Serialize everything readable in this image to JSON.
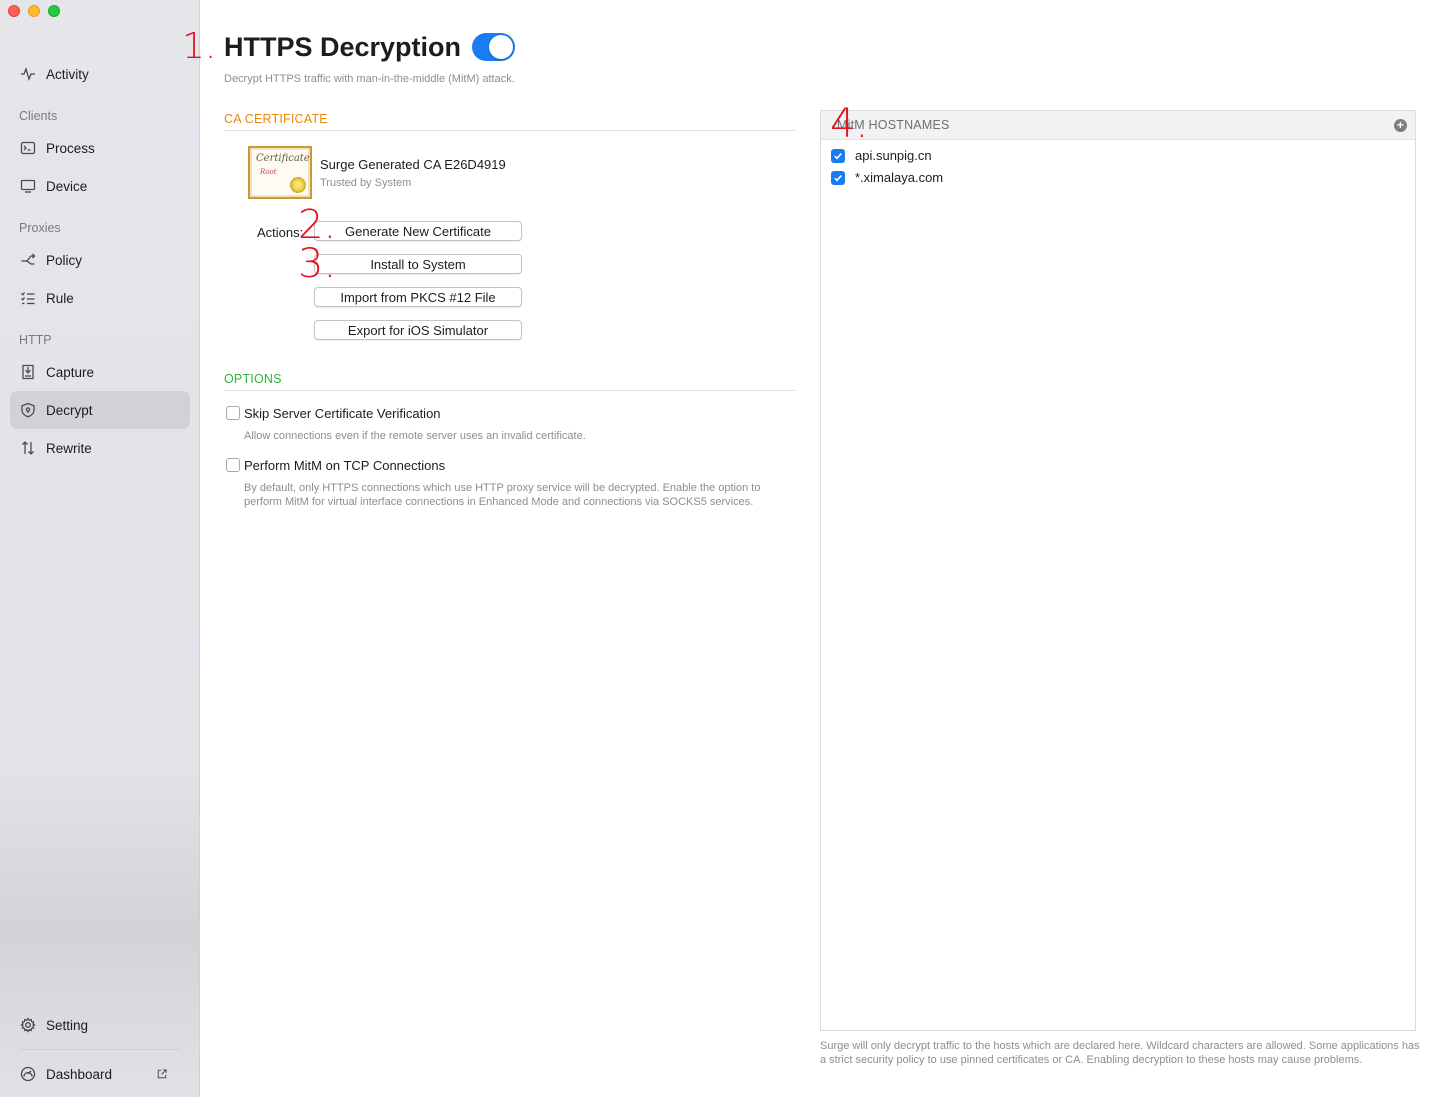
{
  "sidebar": {
    "activity": "Activity",
    "sections": {
      "clients": "Clients",
      "proxies": "Proxies",
      "http": "HTTP"
    },
    "items": {
      "process": "Process",
      "device": "Device",
      "policy": "Policy",
      "rule": "Rule",
      "capture": "Capture",
      "decrypt": "Decrypt",
      "rewrite": "Rewrite"
    },
    "setting": "Setting",
    "dashboard": "Dashboard",
    "active_item": "Decrypt"
  },
  "annotations": {
    "a1": "1.",
    "a2": "2.",
    "a3": "3.",
    "a4": "4."
  },
  "page": {
    "title": "HTTPS Decryption",
    "enabled": true,
    "subtitle": "Decrypt HTTPS traffic with man-in-the-middle (MitM) attack."
  },
  "ca": {
    "heading": "CA CERTIFICATE",
    "icon_text": "Certificate",
    "icon_sub": "Root",
    "name": "Surge Generated CA E26D4919",
    "trust": "Trusted by System",
    "actions_label": "Actions:",
    "buttons": {
      "generate": "Generate New Certificate",
      "install": "Install to System",
      "import": "Import from PKCS #12 File",
      "export": "Export for iOS Simulator"
    }
  },
  "options": {
    "heading": "OPTIONS",
    "skip": {
      "label": "Skip Server Certificate Verification",
      "desc": "Allow connections even if the remote server uses an invalid certificate.",
      "checked": false
    },
    "tcp": {
      "label": "Perform MitM on TCP Connections",
      "desc": "By default, only HTTPS connections which use HTTP proxy service will be decrypted. Enable the option to perform MitM for virtual interface connections in Enhanced Mode and connections via SOCKS5 services.",
      "checked": false
    }
  },
  "hostnames": {
    "heading": "MitM HOSTNAMES",
    "items": [
      {
        "host": "api.sunpig.cn",
        "checked": true
      },
      {
        "host": "*.ximalaya.com",
        "checked": true
      }
    ],
    "footer": "Surge will only decrypt traffic to the hosts which are declared here. Wildcard characters are allowed. Some applications has a strict security policy to use pinned certificates or CA. Enabling decryption to these hosts may cause problems."
  },
  "colors": {
    "accent": "#1a7cf3",
    "ca_heading": "#e6890a",
    "options_heading": "#2fb43f",
    "annotation": "#e0141e"
  }
}
